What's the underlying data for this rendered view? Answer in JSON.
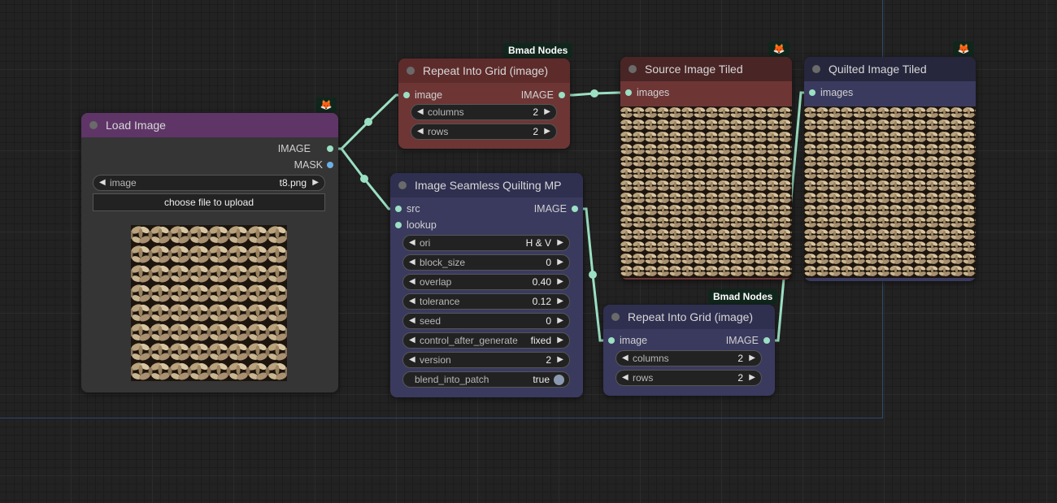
{
  "canvas": {
    "background": "#222222",
    "wire_color": "#9be0c3"
  },
  "icons": {
    "node_badge": "fox-icon",
    "arrow_left": "triangle-left-icon",
    "arrow_right": "triangle-right-icon"
  },
  "glyphs": {
    "fox": "🦊",
    "left": "◀",
    "right": "▶"
  },
  "nodes": {
    "load_image": {
      "title": "Load Image",
      "title_color": "#5f3568",
      "outputs": [
        "IMAGE",
        "MASK"
      ],
      "widget": {
        "label": "image",
        "value": "t8.png"
      },
      "upload_button": "choose file to upload"
    },
    "repeat_grid_top": {
      "title": "Repeat Into Grid (image)",
      "badge": "Bmad Nodes",
      "title_color": "#5e2b2b",
      "input": "image",
      "output": "IMAGE",
      "widgets": [
        {
          "label": "columns",
          "value": "2"
        },
        {
          "label": "rows",
          "value": "2"
        }
      ]
    },
    "quilting": {
      "title": "Image Seamless Quilting MP",
      "title_color": "#2f2f50",
      "inputs": [
        "src",
        "lookup"
      ],
      "output": "IMAGE",
      "widgets": [
        {
          "label": "ori",
          "value": "H & V"
        },
        {
          "label": "block_size",
          "value": "0"
        },
        {
          "label": "overlap",
          "value": "0.40"
        },
        {
          "label": "tolerance",
          "value": "0.12"
        },
        {
          "label": "seed",
          "value": "0"
        },
        {
          "label": "control_after_generate",
          "value": "fixed"
        },
        {
          "label": "version",
          "value": "2"
        }
      ],
      "toggle": {
        "label": "blend_into_patch",
        "value": "true"
      }
    },
    "source_tiled": {
      "title": "Source Image Tiled",
      "title_color": "#4a2525",
      "input": "images"
    },
    "quilted_tiled": {
      "title": "Quilted Image Tiled",
      "title_color": "#26263d",
      "input": "images"
    },
    "repeat_grid_bottom": {
      "title": "Repeat Into Grid (image)",
      "badge": "Bmad Nodes",
      "title_color": "#2f2f50",
      "input": "image",
      "output": "IMAGE",
      "widgets": [
        {
          "label": "columns",
          "value": "2"
        },
        {
          "label": "rows",
          "value": "2"
        }
      ]
    }
  }
}
